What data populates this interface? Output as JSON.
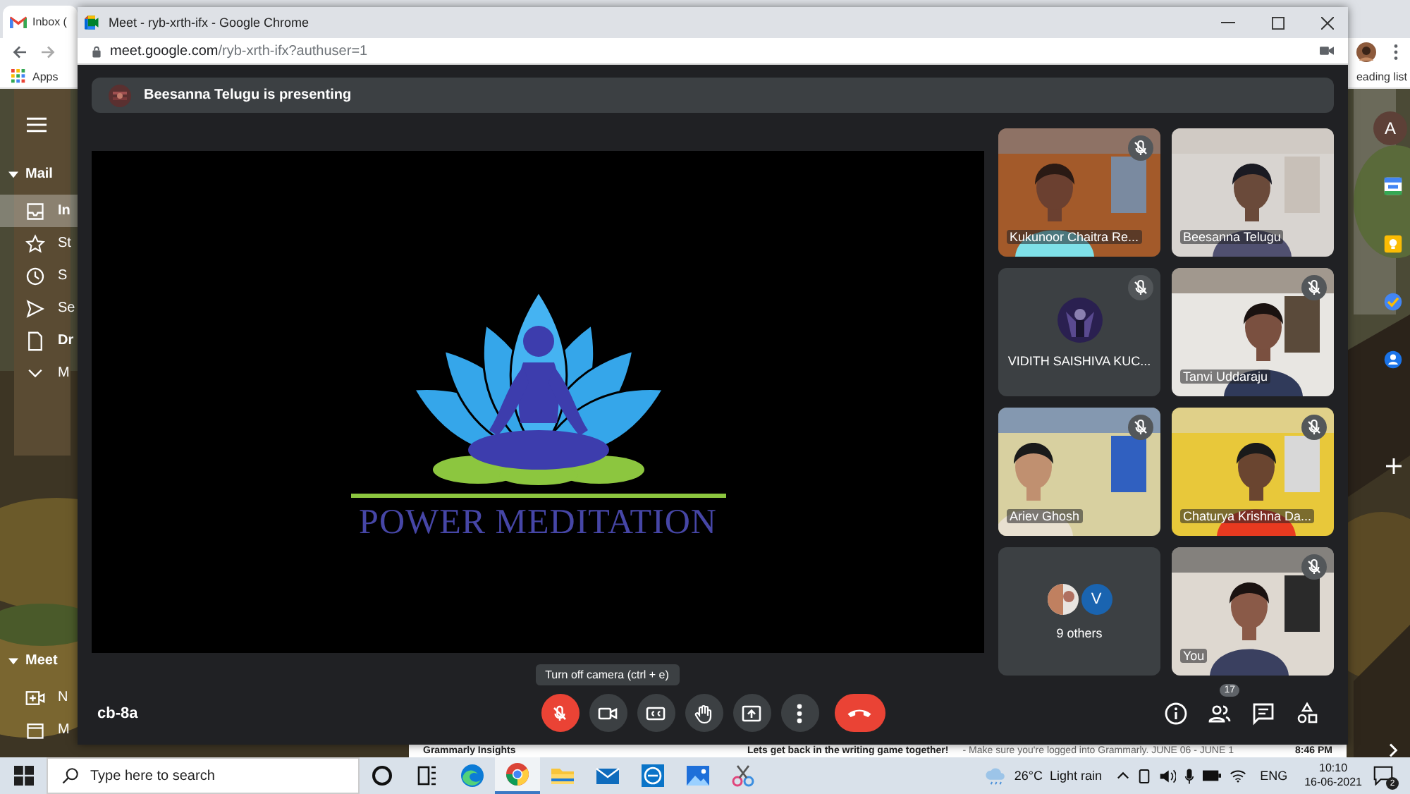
{
  "background_browser": {
    "tab_title": "Inbox (",
    "bookmark": "Apps",
    "reading_list": "eading list",
    "account_initial": "A",
    "mail_section": {
      "title": "Mail",
      "expanded": true,
      "items": [
        {
          "kind": "inbox",
          "label": "In",
          "selected": true,
          "unread": true
        },
        {
          "kind": "star",
          "label": "St",
          "selected": false,
          "unread": false
        },
        {
          "kind": "clock",
          "label": "S",
          "selected": false,
          "unread": false
        },
        {
          "kind": "send",
          "label": "Se",
          "selected": false,
          "unread": false
        },
        {
          "kind": "draft",
          "label": "Dr",
          "selected": false,
          "unread": true
        },
        {
          "kind": "more",
          "label": "M",
          "selected": false,
          "unread": false
        }
      ]
    },
    "meet_section": {
      "title": "Meet",
      "expanded": true,
      "items": [
        {
          "kind": "new-meeting",
          "label": "N",
          "selected": false,
          "unread": false
        },
        {
          "kind": "calendar",
          "label": "M",
          "selected": false,
          "unread": false
        }
      ]
    },
    "email_row": {
      "sender": "Grammarly Insights",
      "subject": "Lets get back in the writing game together!",
      "snippet": "- Make sure you're logged into Grammarly. JUNE 06 - JUNE 1",
      "time": "8:46 PM"
    }
  },
  "window": {
    "title": "Meet - ryb-xrth-ifx - Google Chrome",
    "url_host": "meet.google.com",
    "url_path": "/ryb-xrth-ifx?authuser=1"
  },
  "presenting_banner": {
    "text": "Beesanna Telugu is presenting"
  },
  "stage": {
    "logo_text": "POWER MEDITATION"
  },
  "tiles": [
    {
      "kind": "video",
      "name": "Kukunoor Chaitra Re...",
      "muted": true
    },
    {
      "kind": "video",
      "name": "Beesanna Telugu",
      "muted": false
    },
    {
      "kind": "avatar",
      "name": "VIDITH SAISHIVA KUC...",
      "muted": true
    },
    {
      "kind": "video",
      "name": "Tanvi Uddaraju",
      "muted": true
    },
    {
      "kind": "video",
      "name": "Ariev Ghosh",
      "muted": true
    },
    {
      "kind": "video",
      "name": "Chaturya Krishna Da...",
      "muted": true
    },
    {
      "kind": "others",
      "name": "9 others",
      "avatar_letter": "V",
      "muted": false
    },
    {
      "kind": "video",
      "name": "You",
      "muted": true
    }
  ],
  "meeting_code": "cb-8a",
  "tooltip": "Turn off camera (ctrl + e)",
  "controls": [
    {
      "kind": "mic",
      "on": false
    },
    {
      "kind": "camera",
      "on": true
    },
    {
      "kind": "captions"
    },
    {
      "kind": "raise-hand"
    },
    {
      "kind": "present"
    },
    {
      "kind": "more"
    },
    {
      "kind": "end-call"
    }
  ],
  "side_controls": [
    {
      "kind": "info"
    },
    {
      "kind": "people",
      "badge": "17"
    },
    {
      "kind": "chat"
    },
    {
      "kind": "activities"
    }
  ],
  "taskbar": {
    "search_placeholder": "Type here to search",
    "apps": [
      {
        "kind": "cortana",
        "active": false
      },
      {
        "kind": "task-view",
        "active": false
      },
      {
        "kind": "edge",
        "active": false
      },
      {
        "kind": "chrome",
        "active": true
      },
      {
        "kind": "files",
        "active": false
      },
      {
        "kind": "mail",
        "active": false
      },
      {
        "kind": "dell",
        "active": false
      },
      {
        "kind": "photos",
        "active": false
      },
      {
        "kind": "snip",
        "active": false
      }
    ],
    "temperature": "26°C",
    "weather": "Light rain",
    "language": "ENG",
    "time": "10:10",
    "date": "16-06-2021",
    "notification_count": "2"
  }
}
